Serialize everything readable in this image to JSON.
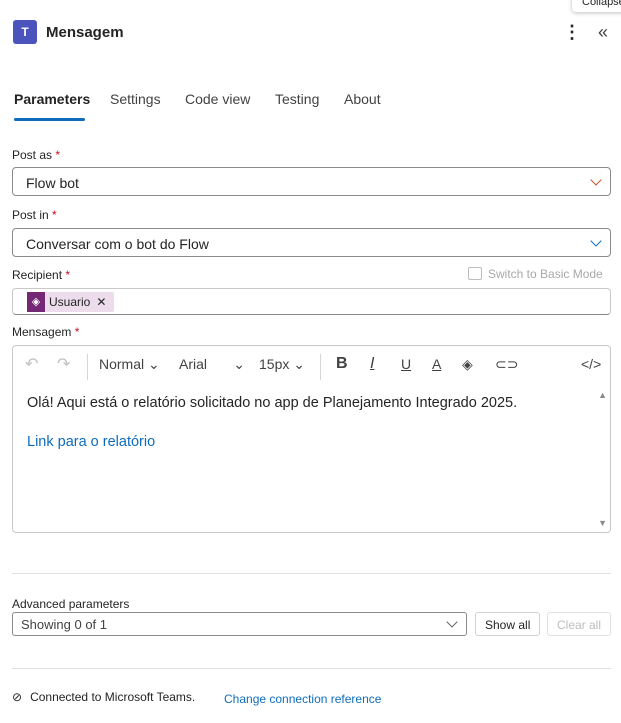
{
  "tooltip": "Collapse",
  "header": {
    "title": "Mensagem",
    "logo_letter": "T",
    "more_icon": "more-vertical-icon",
    "collapse_icon": "double-chevron-left-icon"
  },
  "tabs": [
    {
      "label": "Parameters",
      "active": true
    },
    {
      "label": "Settings"
    },
    {
      "label": "Code view"
    },
    {
      "label": "Testing"
    },
    {
      "label": "About"
    }
  ],
  "fields": {
    "post_as": {
      "label": "Post as",
      "required": "*",
      "value": "Flow bot"
    },
    "post_in": {
      "label": "Post in",
      "required": "*",
      "value": "Conversar com o bot do Flow"
    },
    "recipient": {
      "label": "Recipient",
      "required": "*",
      "token": "Usuario",
      "switch_label": "Switch to Basic Mode"
    },
    "mensagem": {
      "label": "Mensagem",
      "required": "*",
      "toolbar": {
        "style": "Normal",
        "font": "Arial",
        "size": "15px"
      },
      "text": "Olá! Aqui está o relatório solicitado no app de Planejamento Integrado 2025.",
      "link": "Link para o relatório"
    }
  },
  "advanced": {
    "label": "Advanced parameters",
    "value": "Showing 0 of 1",
    "show_all": "Show all",
    "clear_all": "Clear all"
  },
  "footer": {
    "connected": "Connected to Microsoft Teams.",
    "change": "Change connection reference"
  },
  "colors": {
    "accent": "#0f6cbd",
    "teams": "#4b53bc",
    "token": "#742774",
    "required": "#c50f1f"
  }
}
